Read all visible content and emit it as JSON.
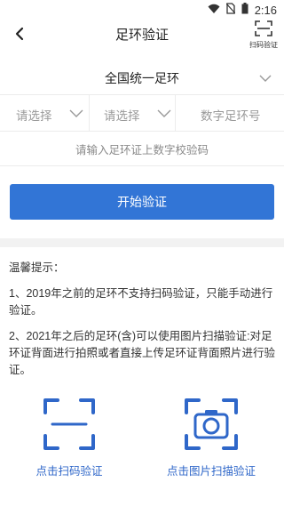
{
  "status_bar": {
    "time": "2:16"
  },
  "header": {
    "title": "足环验证",
    "scan_label": "扫码验证"
  },
  "region": {
    "value": "全国统一足环"
  },
  "inputs": {
    "select1_placeholder": "请选择",
    "select2_placeholder": "请选择",
    "number_placeholder": "数字足环号"
  },
  "hint": "请输入足环证上数字校验码",
  "submit_label": "开始验证",
  "tips": {
    "title": "温馨提示：",
    "items": [
      "1、2019年之前的足环不支持扫码验证，只能手动进行验证。",
      "2、2021年之后的足环(含)可以使用图片扫描验证:对足环证背面进行拍照或者直接上传足环证背面照片进行验证。"
    ]
  },
  "actions": {
    "scan_label": "点击扫码验证",
    "photo_label": "点击图片扫描验证"
  },
  "colors": {
    "accent": "#3275d6",
    "link": "#2f67c9"
  }
}
